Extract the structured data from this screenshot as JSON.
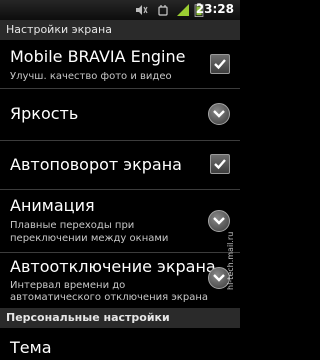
{
  "status_bar": {
    "time": "23:28",
    "icons": [
      "mute-icon",
      "debug-icon",
      "signal-icon",
      "battery-icon"
    ]
  },
  "sections": {
    "screen_settings": "Настройки экрана",
    "personal_settings": "Персональные настройки"
  },
  "items": [
    {
      "title": "Mobile BRAVIA Engine",
      "subtitle": "Улучш. качество фото и видео",
      "control": "checkbox",
      "checked": true
    },
    {
      "title": "Яркость",
      "control": "chevron"
    },
    {
      "title": "Автоповорот экрана",
      "control": "checkbox",
      "checked": true
    },
    {
      "title": "Анимация",
      "subtitle_line1": "Плавные переходы при",
      "subtitle_line2": "переключении между окнами",
      "control": "chevron"
    },
    {
      "title": "Автоотключение экрана",
      "subtitle_line1": "Интервал времени до",
      "subtitle_line2": "автоматического отключения экрана",
      "control": "chevron"
    },
    {
      "title": "Тема"
    }
  ],
  "watermark": "hi-tech.mail.ru",
  "colors": {
    "background": "#000000",
    "header": "#2a2a2a",
    "divider": "#3c3c3c"
  }
}
